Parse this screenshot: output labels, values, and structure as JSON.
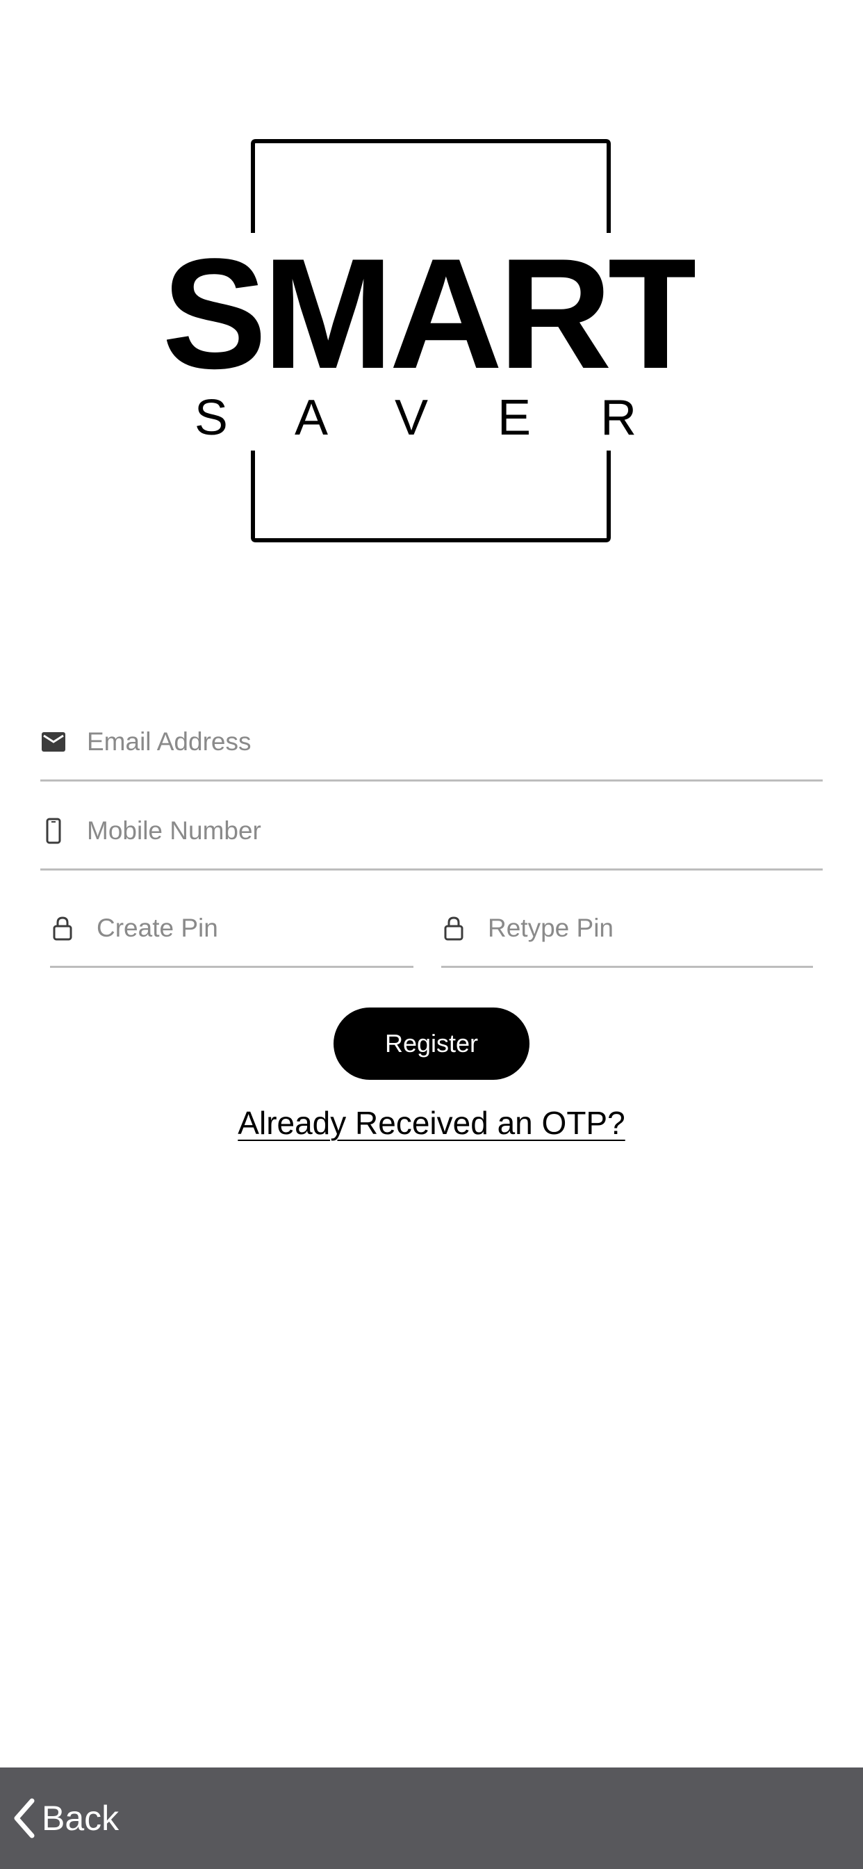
{
  "logo": {
    "brand_word": "SMART",
    "sub_word": "S A V E R"
  },
  "form": {
    "email_placeholder": "Email Address",
    "email_value": "",
    "mobile_placeholder": "Mobile Number",
    "mobile_value": "",
    "create_pin_placeholder": "Create Pin",
    "create_pin_value": "",
    "retype_pin_placeholder": "Retype Pin",
    "retype_pin_value": "",
    "register_label": "Register",
    "otp_link_label": "Already Received an OTP?"
  },
  "bottom_bar": {
    "back_label": "Back",
    "back_icon": "chevron-left-icon",
    "color": "#58585c"
  },
  "icons": {
    "email": "envelope-icon",
    "mobile": "phone-icon",
    "pin": "lock-icon"
  },
  "colors": {
    "accent": "#000000",
    "background": "#ffffff",
    "divider": "#bdbdbd",
    "placeholder": "#8a8a8a"
  }
}
